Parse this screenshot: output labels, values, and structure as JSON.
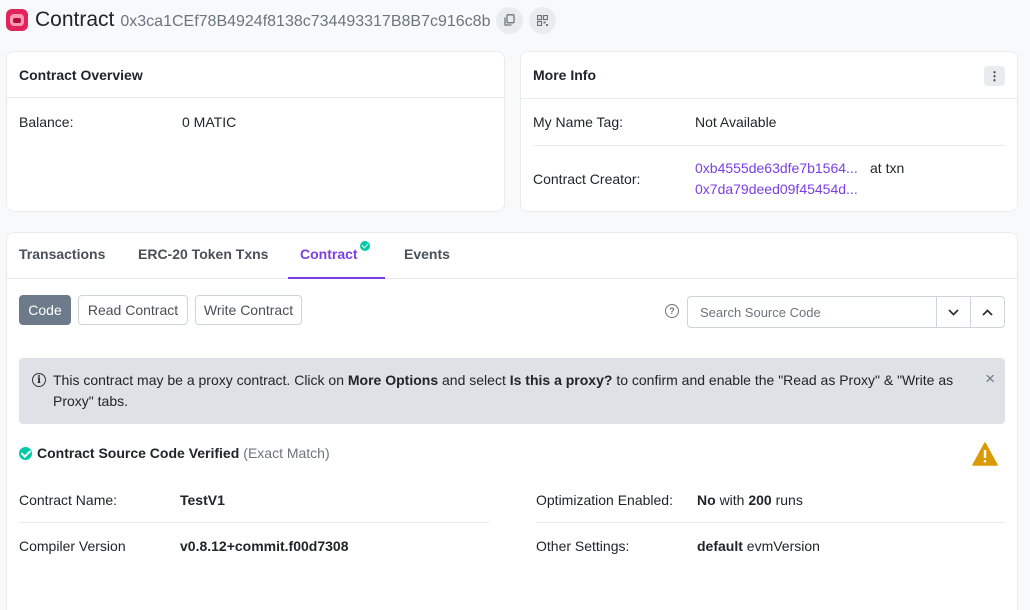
{
  "header": {
    "title": "Contract",
    "address": "0x3ca1CEf78B4924f8138c734493317B8B7c916c8b"
  },
  "overview": {
    "title": "Contract Overview",
    "balance_label": "Balance:",
    "balance_value": "0 MATIC"
  },
  "more_info": {
    "title": "More Info",
    "name_tag_label": "My Name Tag:",
    "name_tag_value": "Not Available",
    "creator_label": "Contract Creator:",
    "creator_address": "0xb4555de63dfe7b1564...",
    "at_txn": "at txn",
    "creator_txn": "0x7da79deed09f45454d..."
  },
  "tabs": [
    {
      "label": "Transactions"
    },
    {
      "label": "ERC-20 Token Txns"
    },
    {
      "label": "Contract"
    },
    {
      "label": "Events"
    }
  ],
  "subtabs": [
    {
      "label": "Code"
    },
    {
      "label": "Read Contract"
    },
    {
      "label": "Write Contract"
    }
  ],
  "search": {
    "placeholder": "Search Source Code"
  },
  "alert": {
    "text1": "This contract may be a proxy contract. Click on ",
    "bold1": "More Options",
    "text2": " and select ",
    "bold2": "Is this a proxy?",
    "text3": " to confirm and enable the \"Read as Proxy\" & \"Write as Proxy\" tabs.",
    "close": "×"
  },
  "verified": {
    "label": "Contract Source Code Verified",
    "match": "(Exact Match)"
  },
  "details": {
    "name_label": "Contract Name:",
    "name_value": "TestV1",
    "compiler_label": "Compiler Version",
    "compiler_value": "v0.8.12+commit.f00d7308",
    "opt_label": "Optimization Enabled:",
    "opt_value": "No",
    "opt_with": "with",
    "opt_runs": "200",
    "opt_runs_word": "runs",
    "other_label": "Other Settings:",
    "other_value": "default",
    "other_suffix": "evmVersion"
  },
  "colors": {
    "accent": "#7b3fe4",
    "verified": "#00c9a7",
    "warning": "#db9a04"
  }
}
